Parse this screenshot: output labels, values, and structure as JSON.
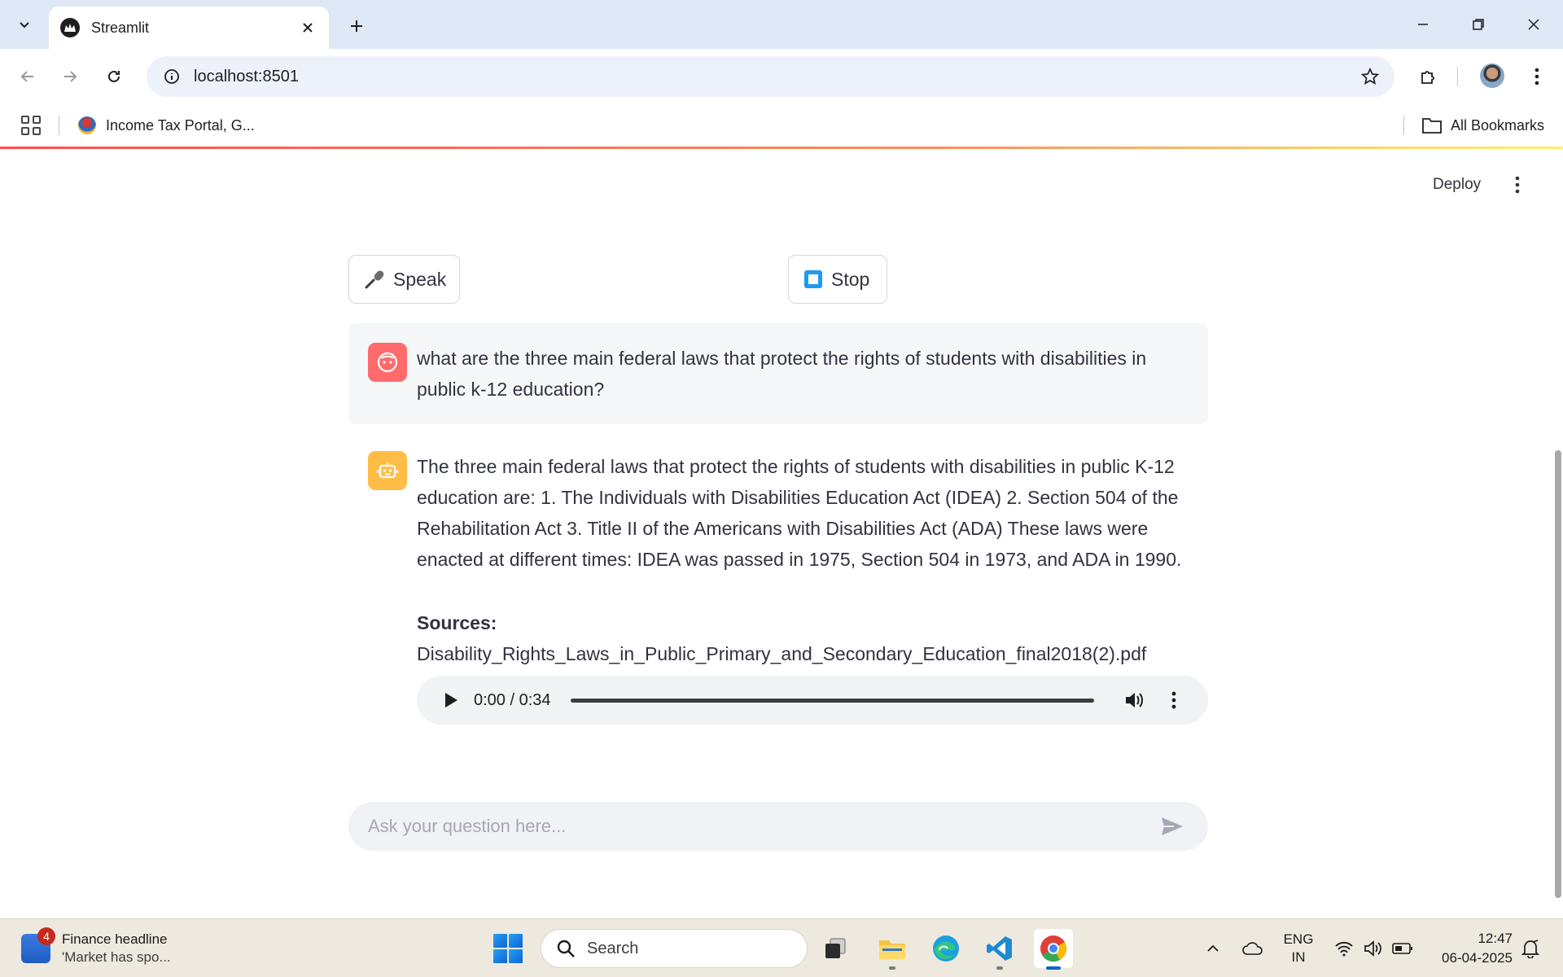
{
  "browser": {
    "tab_title": "Streamlit",
    "url": "localhost:8501",
    "bookmarks": [
      {
        "label": "Income Tax Portal, G..."
      }
    ],
    "all_bookmarks_label": "All Bookmarks"
  },
  "app": {
    "deploy_label": "Deploy",
    "speak_label": "Speak",
    "stop_label": "Stop",
    "messages": [
      {
        "role": "user",
        "avatar_color": "#ff6b6b",
        "text": "what are the three main federal laws that protect the rights of students with disabilities in public k-12 education?"
      },
      {
        "role": "assistant",
        "avatar_color": "#ffbd45",
        "text": "The three main federal laws that protect the rights of students with disabilities in public K-12 education are: 1. The Individuals with Disabilities Education Act (IDEA) 2. Section 504 of the Rehabilitation Act 3. Title II of the Americans with Disabilities Act (ADA) These laws were enacted at different times: IDEA was passed in 1975, Section 504 in 1973, and ADA in 1990.",
        "sources_label": "Sources:",
        "source_file": "Disability_Rights_Laws_in_Public_Primary_and_Secondary_Education_final2018(2).pdf",
        "audio": {
          "time": "0:00 / 0:34",
          "progress": 0
        }
      }
    ],
    "chat_placeholder": "Ask your question here..."
  },
  "taskbar": {
    "widget_badge": "4",
    "widget_title": "Finance headline",
    "widget_subtitle": "'Market has spo...",
    "search_label": "Search",
    "apps": [
      "task-view",
      "file-explorer",
      "edge",
      "vscode",
      "chrome"
    ],
    "lang_line1": "ENG",
    "lang_line2": "IN",
    "time": "12:47",
    "date": "06-04-2025"
  },
  "colors": {
    "accent": "#ff4b4b",
    "user_avatar": "#ff6b6b",
    "bot_avatar": "#ffbd45",
    "stop_icon": "#1e9bf0"
  }
}
